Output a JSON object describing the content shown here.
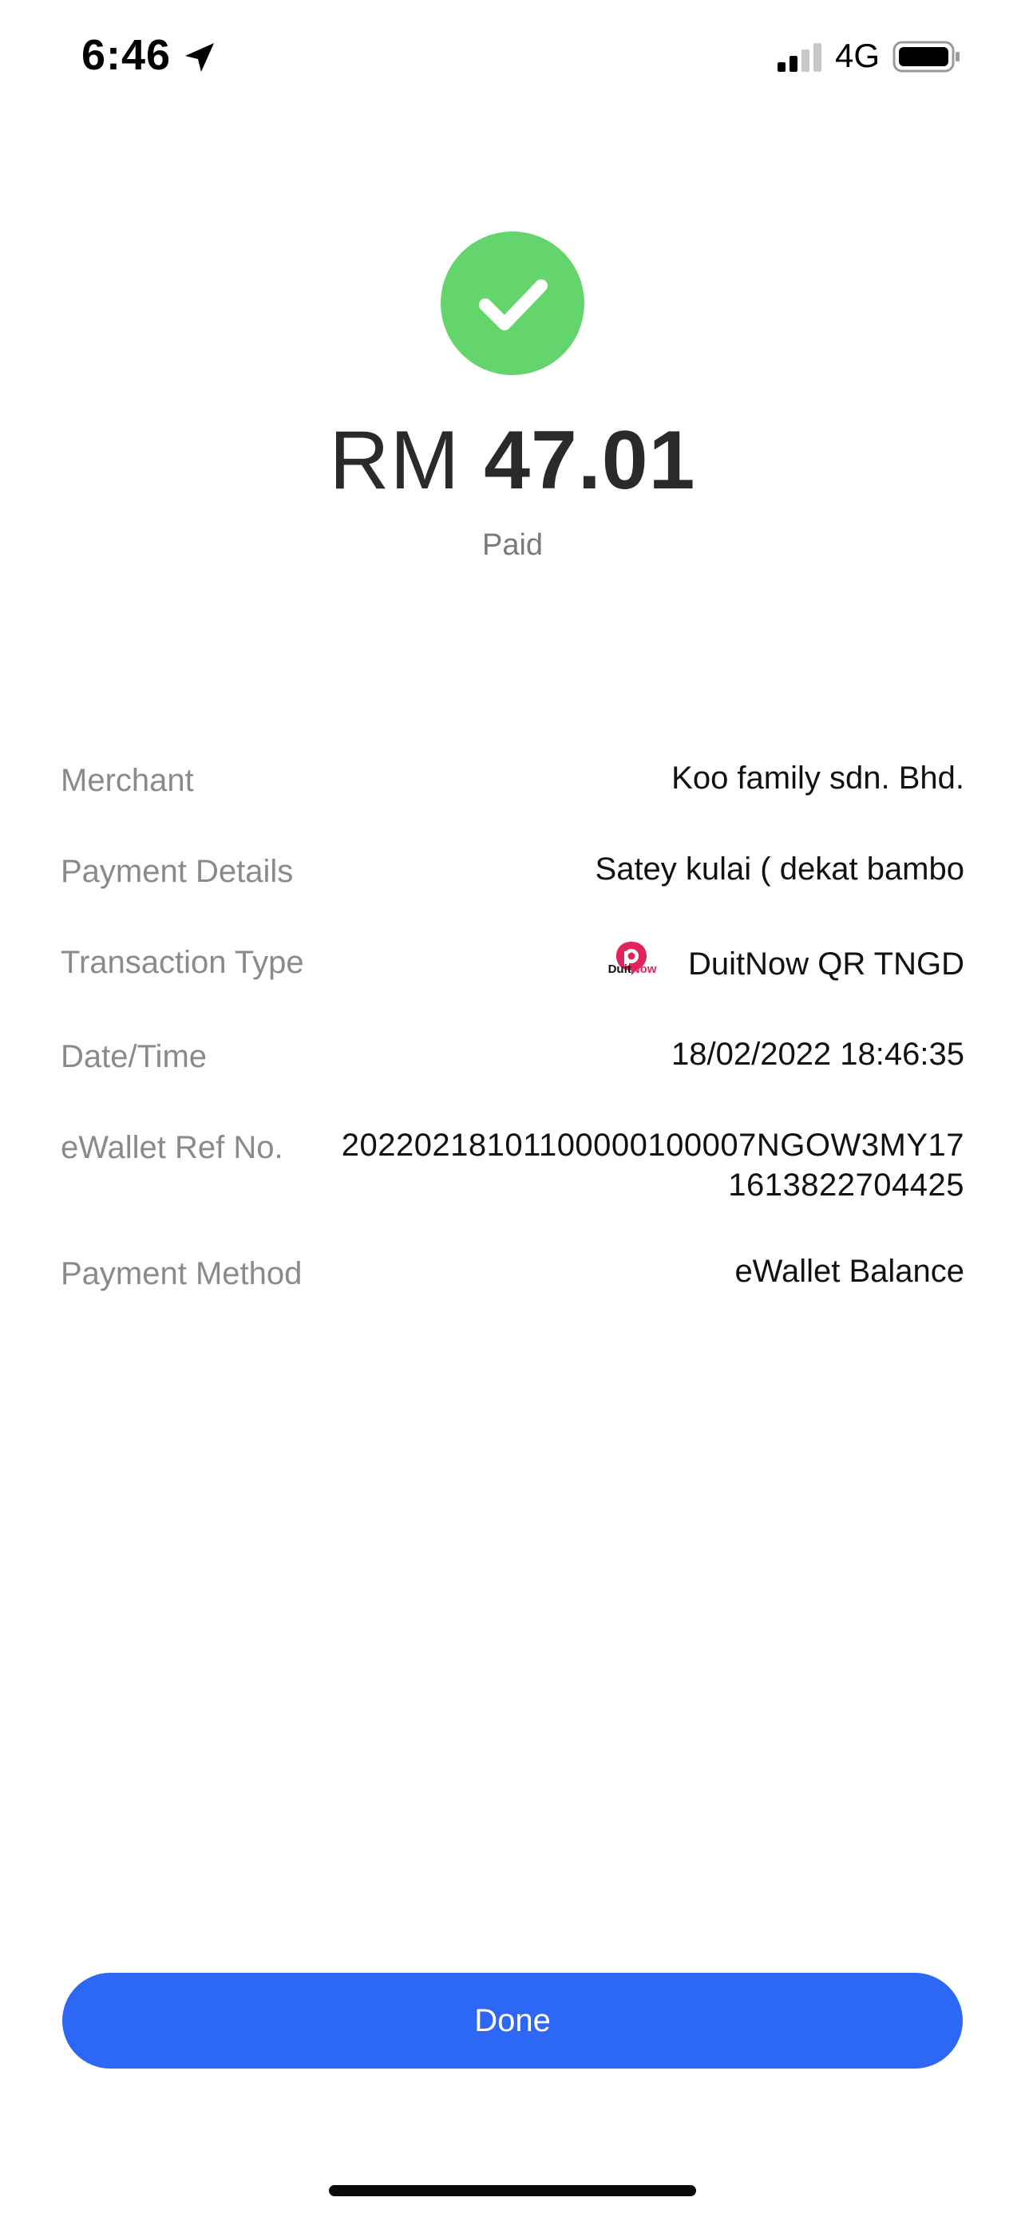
{
  "status_bar": {
    "time": "6:46",
    "network": "4G",
    "icons": [
      "location-arrow-icon",
      "signal-icon",
      "battery-icon"
    ]
  },
  "payment": {
    "currency": "RM",
    "amount": "47.01",
    "status": "Paid",
    "status_color": "#64d56d"
  },
  "details": {
    "merchant": {
      "label": "Merchant",
      "value": "Koo family sdn. Bhd."
    },
    "payment_details": {
      "label": "Payment Details",
      "value": "Satey kulai ( dekat bambo"
    },
    "transaction_type": {
      "label": "Transaction Type",
      "value": "DuitNow QR TNGD",
      "logo_text_a": "Duit",
      "logo_text_b": "Now",
      "logo_color": "#e0245e"
    },
    "datetime": {
      "label": "Date/Time",
      "value": "18/02/2022 18:46:35"
    },
    "ref_no": {
      "label": "eWallet Ref No.",
      "value_line1": "20220218101100000100007NGOW3MY17",
      "value_line2": "1613822704425"
    },
    "payment_method": {
      "label": "Payment Method",
      "value": "eWallet Balance"
    }
  },
  "actions": {
    "done_label": "Done",
    "accent_color": "#2d67f6"
  }
}
